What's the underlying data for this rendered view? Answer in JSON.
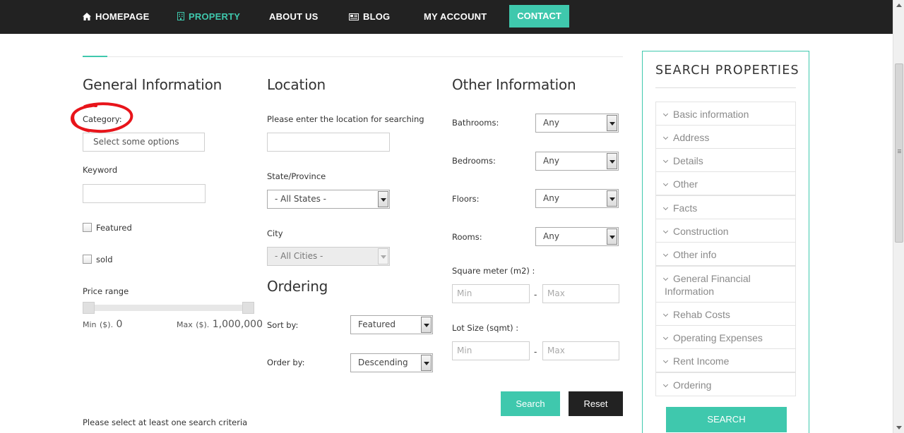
{
  "nav": {
    "items": [
      {
        "label": "HOMEPAGE",
        "icon": "home-icon"
      },
      {
        "label": "PROPERTY",
        "icon": "building-icon",
        "active": true
      },
      {
        "label": "ABOUT US"
      },
      {
        "label": "BLOG",
        "icon": "newspaper-icon"
      },
      {
        "label": "MY ACCOUNT"
      }
    ],
    "contact_label": "CONTACT",
    "accent_color": "#3fc8ad",
    "background_color": "#222222"
  },
  "general": {
    "title": "General Information",
    "category_label": "Category:",
    "category_placeholder": "Select some options",
    "keyword_label": "Keyword",
    "keyword_value": "",
    "featured_label": "Featured",
    "sold_label": "sold",
    "price_range_label": "Price range",
    "price_min_prefix": "Min",
    "price_min_currency": "($).",
    "price_min_value": "0",
    "price_max_prefix": "Max",
    "price_max_currency": "($).",
    "price_max_value": "1,000,000",
    "price_min_fraction": 0,
    "price_max_fraction": 1
  },
  "location": {
    "title": "Location",
    "location_label": "Please enter the location for searching",
    "location_value": "",
    "state_label": "State/Province",
    "state_value": "- All States -",
    "city_label": "City",
    "city_value": "- All Cities -"
  },
  "ordering": {
    "title": "Ordering",
    "sort_label": "Sort by:",
    "sort_value": "Featured",
    "order_label": "Order by:",
    "order_value": "Descending"
  },
  "other": {
    "title": "Other Information",
    "bathrooms_label": "Bathrooms:",
    "bathrooms_value": "Any",
    "bedrooms_label": "Bedrooms:",
    "bedrooms_value": "Any",
    "floors_label": "Floors:",
    "floors_value": "Any",
    "rooms_label": "Rooms:",
    "rooms_value": "Any",
    "sqm_label": "Square meter (m2) :",
    "sqm_min_placeholder": "Min",
    "sqm_max_placeholder": "Max",
    "lot_label": "Lot Size (sqmt) :",
    "lot_min_placeholder": "Min",
    "lot_max_placeholder": "Max",
    "dash": "-"
  },
  "buttons": {
    "search_label": "Search",
    "reset_label": "Reset"
  },
  "notice": "Please select at least one search criteria",
  "sidebar": {
    "title": "SEARCH PROPERTIES",
    "items": [
      {
        "label": "Basic information"
      },
      {
        "label": "Address"
      },
      {
        "label": "Details"
      },
      {
        "label": "Other"
      },
      {
        "label": "Facts"
      },
      {
        "label": "Construction"
      },
      {
        "label": "Other info"
      },
      {
        "label": "General Financial Information"
      },
      {
        "label": "Rehab Costs"
      },
      {
        "label": "Operating Expenses"
      },
      {
        "label": "Rent Income"
      },
      {
        "label": "Ordering"
      }
    ],
    "search_label": "SEARCH"
  }
}
